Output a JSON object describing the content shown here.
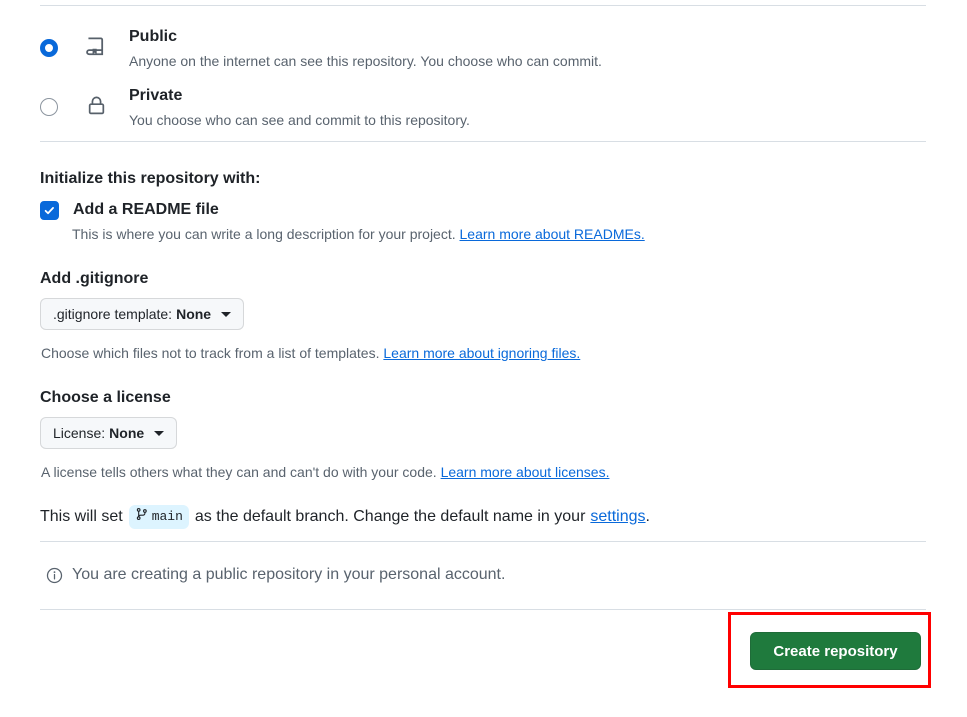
{
  "visibility": {
    "options": [
      {
        "id": "public",
        "title": "Public",
        "description": "Anyone on the internet can see this repository. You choose who can commit.",
        "icon": "repo-icon",
        "selected": true
      },
      {
        "id": "private",
        "title": "Private",
        "description": "You choose who can see and commit to this repository.",
        "icon": "lock-icon",
        "selected": false
      }
    ]
  },
  "initialize": {
    "heading": "Initialize this repository with:",
    "readme": {
      "label": "Add a README file",
      "checked": true,
      "helper_text": "This is where you can write a long description for your project.",
      "helper_link": "Learn more about READMEs."
    }
  },
  "gitignore": {
    "heading": "Add .gitignore",
    "select_lead": ".gitignore template:",
    "select_value": "None",
    "helper_text": "Choose which files not to track from a list of templates.",
    "helper_link": "Learn more about ignoring files."
  },
  "license": {
    "heading": "Choose a license",
    "select_lead": "License:",
    "select_value": "None",
    "helper_text": "A license tells others what they can and can't do with your code.",
    "helper_link": "Learn more about licenses."
  },
  "default_branch": {
    "text_before": "This will set",
    "branch_name": "main",
    "text_after": "as the default branch. Change the default name in your",
    "settings_link": "settings",
    "text_end": "."
  },
  "notice": {
    "icon": "info-icon",
    "text": "You are creating a public repository in your personal account."
  },
  "footer": {
    "create_button_label": "Create repository"
  },
  "colors": {
    "accent_blue": "#0969da",
    "button_green": "#1f7a3d",
    "highlight_red": "#ff0000",
    "branch_badge_bg": "#ddf4ff",
    "muted_text": "#59636e",
    "divider": "#d8dee4"
  }
}
